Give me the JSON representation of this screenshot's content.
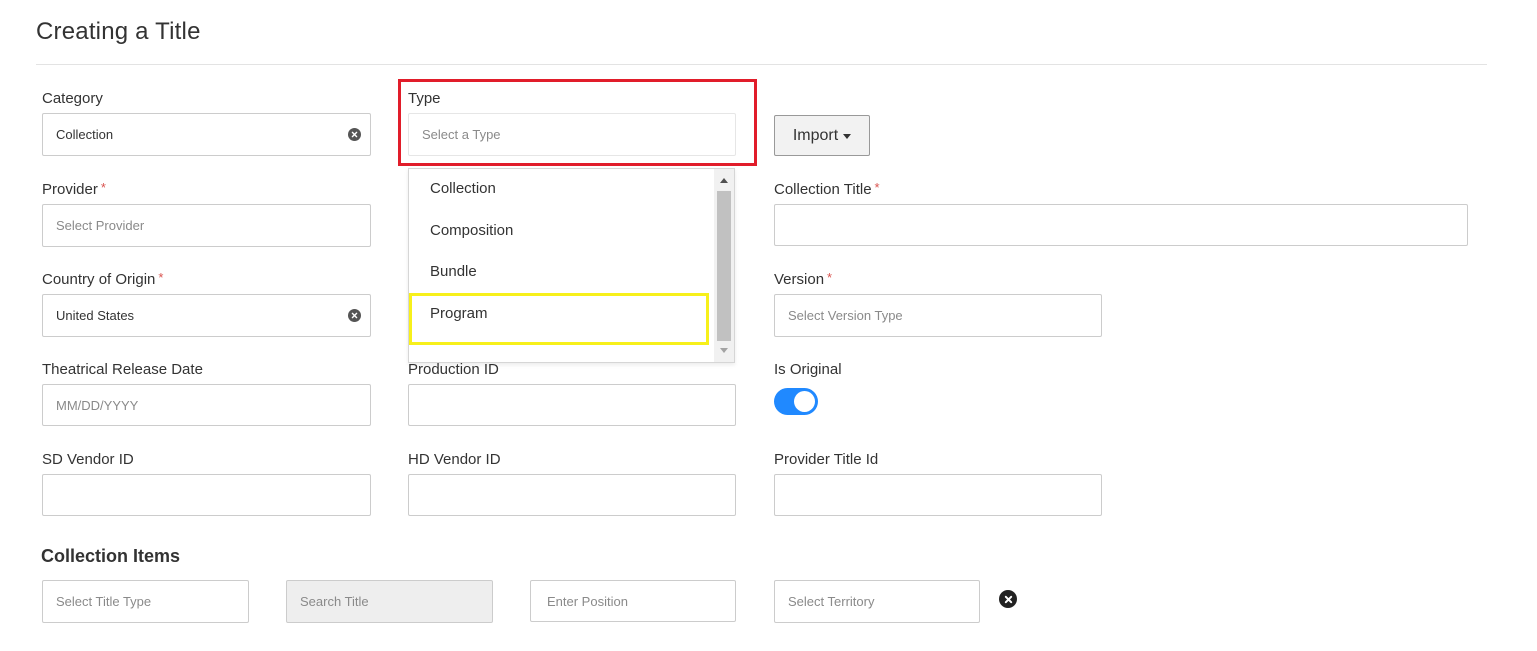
{
  "page": {
    "title": "Creating a Title"
  },
  "form": {
    "category": {
      "label": "Category",
      "value": "Collection"
    },
    "type": {
      "label": "Type",
      "placeholder": "Select a Type"
    },
    "import_button": {
      "label": "Import"
    },
    "type_options": [
      "Collection",
      "Composition",
      "Bundle",
      "Program"
    ],
    "provider": {
      "label": "Provider",
      "required_mark": "*",
      "placeholder": "Select Provider"
    },
    "collection_title": {
      "label": "Collection Title",
      "required_mark": "*",
      "value": ""
    },
    "country_of_origin": {
      "label": "Country of Origin",
      "required_mark": "*",
      "value": "United States"
    },
    "version": {
      "label": "Version",
      "required_mark": "*",
      "placeholder": "Select Version Type"
    },
    "theatrical_release_date": {
      "label": "Theatrical Release Date",
      "placeholder": "MM/DD/YYYY"
    },
    "production_id": {
      "label": "Production ID",
      "value": ""
    },
    "is_original": {
      "label": "Is Original",
      "on": true
    },
    "sd_vendor_id": {
      "label": "SD Vendor ID",
      "value": ""
    },
    "hd_vendor_id": {
      "label": "HD Vendor ID",
      "value": ""
    },
    "provider_title_id": {
      "label": "Provider Title Id",
      "value": ""
    }
  },
  "collection_items": {
    "title": "Collection Items",
    "title_type_placeholder": "Select Title Type",
    "search_title_placeholder": "Search Title",
    "position_placeholder": "Enter Position",
    "territory_placeholder": "Select Territory"
  },
  "colors": {
    "highlight_red": "#e11d2a",
    "highlight_yellow": "#f7f01b",
    "toggle_on": "#2089ff",
    "required": "#d9534f"
  }
}
